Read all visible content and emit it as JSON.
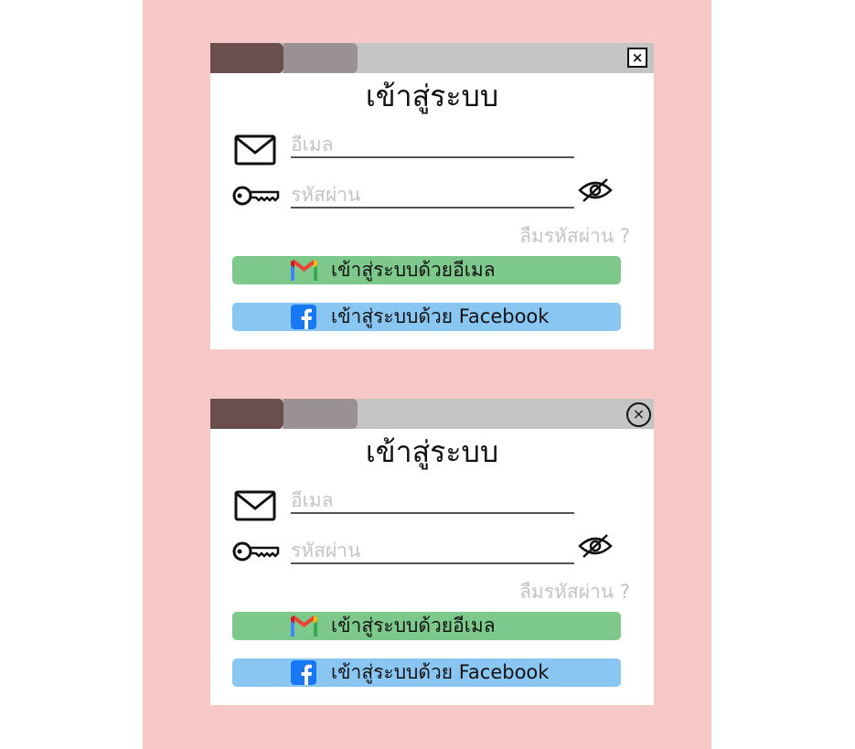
{
  "variants": [
    {
      "close_glyph": "×",
      "close_style": "square",
      "title": "เข้าสู่ระบบ",
      "email_placeholder": "อีเมล",
      "password_placeholder": "รหัสผ่าน",
      "forgot_label": "ลืมรหัสผ่าน ?",
      "gmail_button_label": "เข้าสู่ระบบด้วยอีเมล",
      "facebook_button_label": "เข้าสู่ระบบด้วย Facebook"
    },
    {
      "close_glyph": "×",
      "close_style": "circle",
      "title": "เข้าสู่ระบบ",
      "email_placeholder": "อีเมล",
      "password_placeholder": "รหัสผ่าน",
      "forgot_label": "ลืมรหัสผ่าน ?",
      "gmail_button_label": "เข้าสู่ระบบด้วยอีเมล",
      "facebook_button_label": "เข้าสู่ระบบด้วย Facebook"
    }
  ],
  "icons": {
    "close": "close-icon",
    "email": "mail-icon",
    "password": "key-icon",
    "toggle_password": "eye-off-icon",
    "gmail": "gmail-icon",
    "facebook": "facebook-icon"
  },
  "colors": {
    "background": "#f6c8c8",
    "titlebar": "#c4c4c4",
    "tab_active": "#6b4e4e",
    "tab_secondary": "#9a9292",
    "gmail_button": "#7dc98c",
    "facebook_button": "#8ac6f2",
    "placeholder": "#c4c4c4",
    "facebook_blue": "#1877f2"
  }
}
